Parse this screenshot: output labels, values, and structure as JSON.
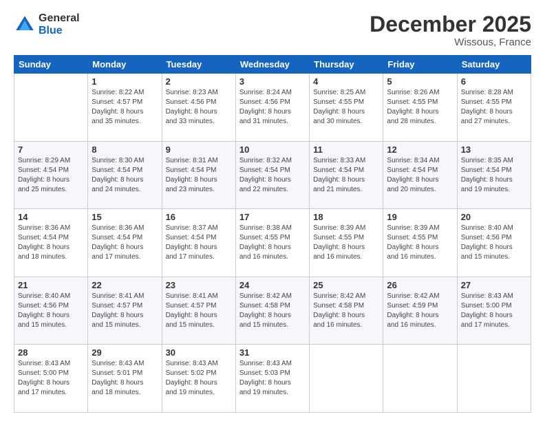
{
  "logo": {
    "general": "General",
    "blue": "Blue"
  },
  "title": "December 2025",
  "subtitle": "Wissous, France",
  "header_days": [
    "Sunday",
    "Monday",
    "Tuesday",
    "Wednesday",
    "Thursday",
    "Friday",
    "Saturday"
  ],
  "weeks": [
    [
      {
        "day": "",
        "info": ""
      },
      {
        "day": "1",
        "info": "Sunrise: 8:22 AM\nSunset: 4:57 PM\nDaylight: 8 hours\nand 35 minutes."
      },
      {
        "day": "2",
        "info": "Sunrise: 8:23 AM\nSunset: 4:56 PM\nDaylight: 8 hours\nand 33 minutes."
      },
      {
        "day": "3",
        "info": "Sunrise: 8:24 AM\nSunset: 4:56 PM\nDaylight: 8 hours\nand 31 minutes."
      },
      {
        "day": "4",
        "info": "Sunrise: 8:25 AM\nSunset: 4:55 PM\nDaylight: 8 hours\nand 30 minutes."
      },
      {
        "day": "5",
        "info": "Sunrise: 8:26 AM\nSunset: 4:55 PM\nDaylight: 8 hours\nand 28 minutes."
      },
      {
        "day": "6",
        "info": "Sunrise: 8:28 AM\nSunset: 4:55 PM\nDaylight: 8 hours\nand 27 minutes."
      }
    ],
    [
      {
        "day": "7",
        "info": "Sunrise: 8:29 AM\nSunset: 4:54 PM\nDaylight: 8 hours\nand 25 minutes."
      },
      {
        "day": "8",
        "info": "Sunrise: 8:30 AM\nSunset: 4:54 PM\nDaylight: 8 hours\nand 24 minutes."
      },
      {
        "day": "9",
        "info": "Sunrise: 8:31 AM\nSunset: 4:54 PM\nDaylight: 8 hours\nand 23 minutes."
      },
      {
        "day": "10",
        "info": "Sunrise: 8:32 AM\nSunset: 4:54 PM\nDaylight: 8 hours\nand 22 minutes."
      },
      {
        "day": "11",
        "info": "Sunrise: 8:33 AM\nSunset: 4:54 PM\nDaylight: 8 hours\nand 21 minutes."
      },
      {
        "day": "12",
        "info": "Sunrise: 8:34 AM\nSunset: 4:54 PM\nDaylight: 8 hours\nand 20 minutes."
      },
      {
        "day": "13",
        "info": "Sunrise: 8:35 AM\nSunset: 4:54 PM\nDaylight: 8 hours\nand 19 minutes."
      }
    ],
    [
      {
        "day": "14",
        "info": "Sunrise: 8:36 AM\nSunset: 4:54 PM\nDaylight: 8 hours\nand 18 minutes."
      },
      {
        "day": "15",
        "info": "Sunrise: 8:36 AM\nSunset: 4:54 PM\nDaylight: 8 hours\nand 17 minutes."
      },
      {
        "day": "16",
        "info": "Sunrise: 8:37 AM\nSunset: 4:54 PM\nDaylight: 8 hours\nand 17 minutes."
      },
      {
        "day": "17",
        "info": "Sunrise: 8:38 AM\nSunset: 4:55 PM\nDaylight: 8 hours\nand 16 minutes."
      },
      {
        "day": "18",
        "info": "Sunrise: 8:39 AM\nSunset: 4:55 PM\nDaylight: 8 hours\nand 16 minutes."
      },
      {
        "day": "19",
        "info": "Sunrise: 8:39 AM\nSunset: 4:55 PM\nDaylight: 8 hours\nand 16 minutes."
      },
      {
        "day": "20",
        "info": "Sunrise: 8:40 AM\nSunset: 4:56 PM\nDaylight: 8 hours\nand 15 minutes."
      }
    ],
    [
      {
        "day": "21",
        "info": "Sunrise: 8:40 AM\nSunset: 4:56 PM\nDaylight: 8 hours\nand 15 minutes."
      },
      {
        "day": "22",
        "info": "Sunrise: 8:41 AM\nSunset: 4:57 PM\nDaylight: 8 hours\nand 15 minutes."
      },
      {
        "day": "23",
        "info": "Sunrise: 8:41 AM\nSunset: 4:57 PM\nDaylight: 8 hours\nand 15 minutes."
      },
      {
        "day": "24",
        "info": "Sunrise: 8:42 AM\nSunset: 4:58 PM\nDaylight: 8 hours\nand 15 minutes."
      },
      {
        "day": "25",
        "info": "Sunrise: 8:42 AM\nSunset: 4:58 PM\nDaylight: 8 hours\nand 16 minutes."
      },
      {
        "day": "26",
        "info": "Sunrise: 8:42 AM\nSunset: 4:59 PM\nDaylight: 8 hours\nand 16 minutes."
      },
      {
        "day": "27",
        "info": "Sunrise: 8:43 AM\nSunset: 5:00 PM\nDaylight: 8 hours\nand 17 minutes."
      }
    ],
    [
      {
        "day": "28",
        "info": "Sunrise: 8:43 AM\nSunset: 5:00 PM\nDaylight: 8 hours\nand 17 minutes."
      },
      {
        "day": "29",
        "info": "Sunrise: 8:43 AM\nSunset: 5:01 PM\nDaylight: 8 hours\nand 18 minutes."
      },
      {
        "day": "30",
        "info": "Sunrise: 8:43 AM\nSunset: 5:02 PM\nDaylight: 8 hours\nand 19 minutes."
      },
      {
        "day": "31",
        "info": "Sunrise: 8:43 AM\nSunset: 5:03 PM\nDaylight: 8 hours\nand 19 minutes."
      },
      {
        "day": "",
        "info": ""
      },
      {
        "day": "",
        "info": ""
      },
      {
        "day": "",
        "info": ""
      }
    ]
  ]
}
